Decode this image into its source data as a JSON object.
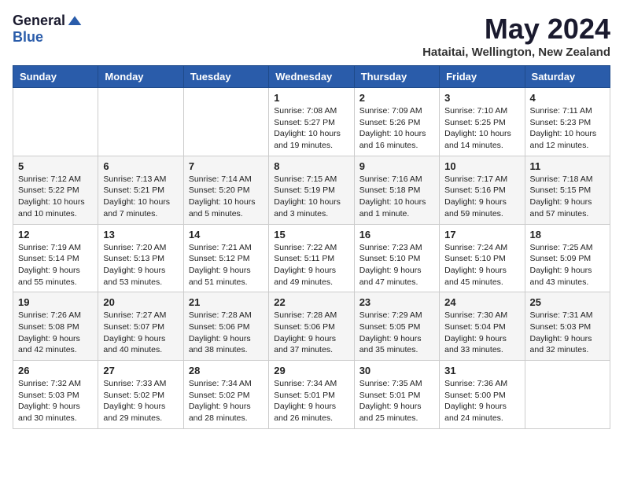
{
  "logo": {
    "general": "General",
    "blue": "Blue"
  },
  "title": "May 2024",
  "subtitle": "Hataitai, Wellington, New Zealand",
  "days_of_week": [
    "Sunday",
    "Monday",
    "Tuesday",
    "Wednesday",
    "Thursday",
    "Friday",
    "Saturday"
  ],
  "weeks": [
    [
      {
        "day": "",
        "info": ""
      },
      {
        "day": "",
        "info": ""
      },
      {
        "day": "",
        "info": ""
      },
      {
        "day": "1",
        "info": "Sunrise: 7:08 AM\nSunset: 5:27 PM\nDaylight: 10 hours\nand 19 minutes."
      },
      {
        "day": "2",
        "info": "Sunrise: 7:09 AM\nSunset: 5:26 PM\nDaylight: 10 hours\nand 16 minutes."
      },
      {
        "day": "3",
        "info": "Sunrise: 7:10 AM\nSunset: 5:25 PM\nDaylight: 10 hours\nand 14 minutes."
      },
      {
        "day": "4",
        "info": "Sunrise: 7:11 AM\nSunset: 5:23 PM\nDaylight: 10 hours\nand 12 minutes."
      }
    ],
    [
      {
        "day": "5",
        "info": "Sunrise: 7:12 AM\nSunset: 5:22 PM\nDaylight: 10 hours\nand 10 minutes."
      },
      {
        "day": "6",
        "info": "Sunrise: 7:13 AM\nSunset: 5:21 PM\nDaylight: 10 hours\nand 7 minutes."
      },
      {
        "day": "7",
        "info": "Sunrise: 7:14 AM\nSunset: 5:20 PM\nDaylight: 10 hours\nand 5 minutes."
      },
      {
        "day": "8",
        "info": "Sunrise: 7:15 AM\nSunset: 5:19 PM\nDaylight: 10 hours\nand 3 minutes."
      },
      {
        "day": "9",
        "info": "Sunrise: 7:16 AM\nSunset: 5:18 PM\nDaylight: 10 hours\nand 1 minute."
      },
      {
        "day": "10",
        "info": "Sunrise: 7:17 AM\nSunset: 5:16 PM\nDaylight: 9 hours\nand 59 minutes."
      },
      {
        "day": "11",
        "info": "Sunrise: 7:18 AM\nSunset: 5:15 PM\nDaylight: 9 hours\nand 57 minutes."
      }
    ],
    [
      {
        "day": "12",
        "info": "Sunrise: 7:19 AM\nSunset: 5:14 PM\nDaylight: 9 hours\nand 55 minutes."
      },
      {
        "day": "13",
        "info": "Sunrise: 7:20 AM\nSunset: 5:13 PM\nDaylight: 9 hours\nand 53 minutes."
      },
      {
        "day": "14",
        "info": "Sunrise: 7:21 AM\nSunset: 5:12 PM\nDaylight: 9 hours\nand 51 minutes."
      },
      {
        "day": "15",
        "info": "Sunrise: 7:22 AM\nSunset: 5:11 PM\nDaylight: 9 hours\nand 49 minutes."
      },
      {
        "day": "16",
        "info": "Sunrise: 7:23 AM\nSunset: 5:10 PM\nDaylight: 9 hours\nand 47 minutes."
      },
      {
        "day": "17",
        "info": "Sunrise: 7:24 AM\nSunset: 5:10 PM\nDaylight: 9 hours\nand 45 minutes."
      },
      {
        "day": "18",
        "info": "Sunrise: 7:25 AM\nSunset: 5:09 PM\nDaylight: 9 hours\nand 43 minutes."
      }
    ],
    [
      {
        "day": "19",
        "info": "Sunrise: 7:26 AM\nSunset: 5:08 PM\nDaylight: 9 hours\nand 42 minutes."
      },
      {
        "day": "20",
        "info": "Sunrise: 7:27 AM\nSunset: 5:07 PM\nDaylight: 9 hours\nand 40 minutes."
      },
      {
        "day": "21",
        "info": "Sunrise: 7:28 AM\nSunset: 5:06 PM\nDaylight: 9 hours\nand 38 minutes."
      },
      {
        "day": "22",
        "info": "Sunrise: 7:28 AM\nSunset: 5:06 PM\nDaylight: 9 hours\nand 37 minutes."
      },
      {
        "day": "23",
        "info": "Sunrise: 7:29 AM\nSunset: 5:05 PM\nDaylight: 9 hours\nand 35 minutes."
      },
      {
        "day": "24",
        "info": "Sunrise: 7:30 AM\nSunset: 5:04 PM\nDaylight: 9 hours\nand 33 minutes."
      },
      {
        "day": "25",
        "info": "Sunrise: 7:31 AM\nSunset: 5:03 PM\nDaylight: 9 hours\nand 32 minutes."
      }
    ],
    [
      {
        "day": "26",
        "info": "Sunrise: 7:32 AM\nSunset: 5:03 PM\nDaylight: 9 hours\nand 30 minutes."
      },
      {
        "day": "27",
        "info": "Sunrise: 7:33 AM\nSunset: 5:02 PM\nDaylight: 9 hours\nand 29 minutes."
      },
      {
        "day": "28",
        "info": "Sunrise: 7:34 AM\nSunset: 5:02 PM\nDaylight: 9 hours\nand 28 minutes."
      },
      {
        "day": "29",
        "info": "Sunrise: 7:34 AM\nSunset: 5:01 PM\nDaylight: 9 hours\nand 26 minutes."
      },
      {
        "day": "30",
        "info": "Sunrise: 7:35 AM\nSunset: 5:01 PM\nDaylight: 9 hours\nand 25 minutes."
      },
      {
        "day": "31",
        "info": "Sunrise: 7:36 AM\nSunset: 5:00 PM\nDaylight: 9 hours\nand 24 minutes."
      },
      {
        "day": "",
        "info": ""
      }
    ]
  ]
}
